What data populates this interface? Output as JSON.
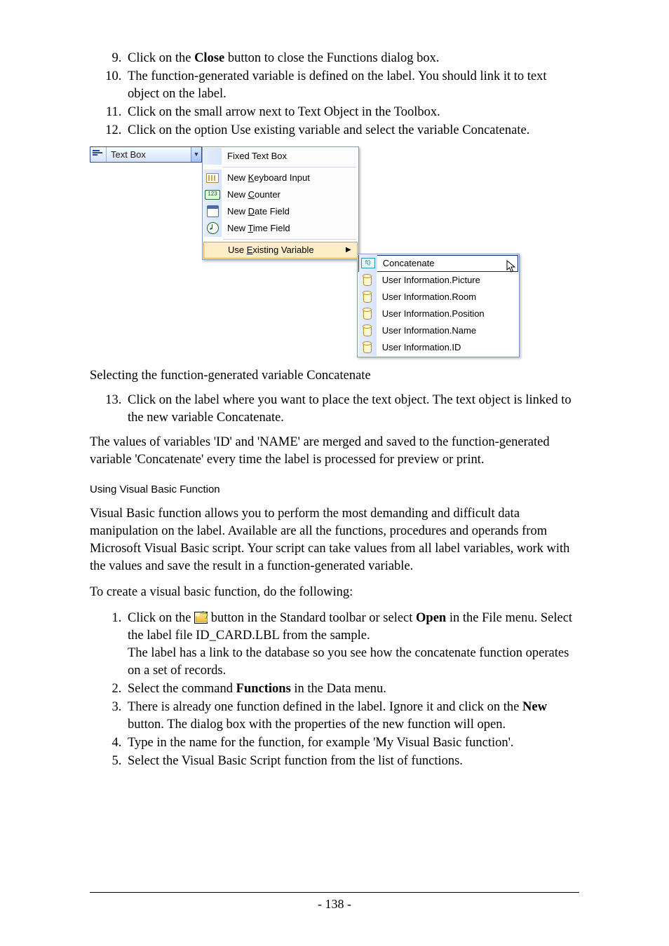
{
  "steps_first": [
    {
      "n": 9,
      "pre": "Click on the ",
      "bold": "Close",
      "post": " button to close the Functions dialog box."
    },
    {
      "n": 10,
      "text": "The function-generated variable is defined on the label. You should link it to text object on the label."
    },
    {
      "n": 11,
      "text": "Click on the small arrow next to Text Object in the Toolbox."
    },
    {
      "n": 12,
      "text": "Click on the option Use existing variable and select the variable Concatenate."
    }
  ],
  "ui": {
    "toolButton": "Text Box",
    "menu": {
      "fixed": "Fixed Text Box",
      "kb_pre": "New ",
      "kb_u": "K",
      "kb_post": "eyboard Input",
      "cnt_pre": "New ",
      "cnt_u": "C",
      "cnt_post": "ounter",
      "date_pre": "New ",
      "date_u": "D",
      "date_post": "ate Field",
      "time_pre": "New ",
      "time_u": "T",
      "time_post": "ime Field",
      "use_pre": "Use ",
      "use_u": "E",
      "use_post": "xisting Variable"
    },
    "sub": {
      "items": [
        "Concatenate",
        "User Information.Picture",
        "User Information.Room",
        "User Information.Position",
        "User Information.Name",
        "User Information.ID"
      ]
    }
  },
  "caption": "Selecting the function-generated variable Concatenate",
  "step13": {
    "n": 13,
    "text": "Click on the label where you want to place the text object. The text object is linked to the new variable Concatenate."
  },
  "para1": "The values of variables 'ID' and 'NAME' are merged and saved to the function-generated variable 'Concatenate' every time the label is processed for preview or print.",
  "section_head": "Using Visual Basic Function",
  "para2": "Visual Basic function allows you to perform the most demanding and difficult data manipulation on the label. Available are all the functions, procedures and operands from Microsoft Visual Basic script. Your script can take values from all label variables, work with the values and save the result in a function-generated variable.",
  "para3": "To create a visual basic function, do the following:",
  "steps_second": {
    "s1": {
      "pre": "Click on the ",
      "mid": " button in the Standard toolbar or select ",
      "bold": "Open",
      "post": " in the File menu. Select the label file ID_CARD.LBL from the sample.",
      "note": " The label has a link to the database so you see how the concatenate function operates on a set of records."
    },
    "s2": {
      "pre": "Select the command ",
      "bold": "Functions",
      "post": " in the Data menu."
    },
    "s3": {
      "pre": "There is already one function defined in the label. Ignore it and click on the ",
      "bold": "New",
      "post": " button.  The dialog box with the properties of the new function will open."
    },
    "s4": "Type in the name for the function, for example 'My Visual Basic function'.",
    "s5": "Select the Visual Basic Script function from the list of functions."
  },
  "page_num": "- 138 -"
}
